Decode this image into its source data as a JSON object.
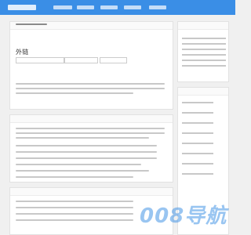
{
  "main": {
    "seo_title_fragment": "外链",
    "use_title_fragment": ""
  },
  "watermark": {
    "brand": "008导航",
    "url": ""
  },
  "colors": {
    "topbar": "#3a8ee6",
    "watermark": "#4696e6"
  }
}
